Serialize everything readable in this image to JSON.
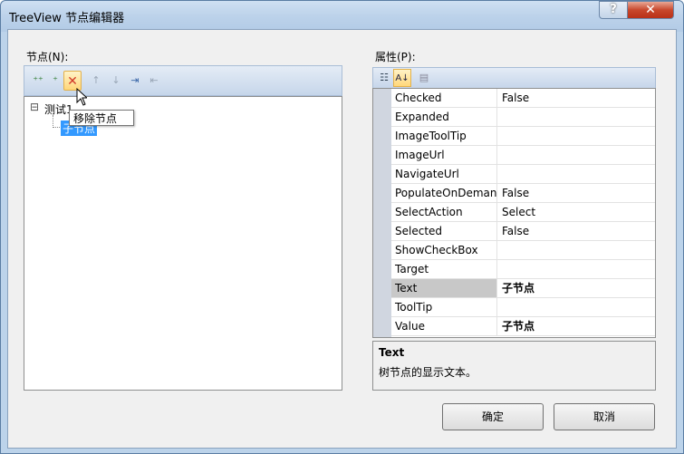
{
  "window": {
    "title": "TreeView 节点编辑器",
    "help_label": "?",
    "close_label": "✕"
  },
  "nodes_panel": {
    "label": "节点(N):",
    "tools": [
      {
        "name": "add-root-node-icon",
        "glyph": "⁺⁺"
      },
      {
        "name": "add-child-node-icon",
        "glyph": "⁺"
      },
      {
        "name": "remove-node-icon",
        "glyph": "✕"
      },
      {
        "name": "move-up-icon",
        "glyph": "↑"
      },
      {
        "name": "move-down-icon",
        "glyph": "↓"
      },
      {
        "name": "indent-icon",
        "glyph": "⇥"
      },
      {
        "name": "outdent-icon",
        "glyph": "⇤"
      }
    ],
    "tree": {
      "root_label": "测试1",
      "root_expander": "⊟",
      "child_label": "子节点"
    },
    "tooltip": "移除节点"
  },
  "properties_panel": {
    "label": "属性(P):",
    "rows": [
      {
        "name": "Checked",
        "value": "False"
      },
      {
        "name": "Expanded",
        "value": ""
      },
      {
        "name": "ImageToolTip",
        "value": ""
      },
      {
        "name": "ImageUrl",
        "value": ""
      },
      {
        "name": "NavigateUrl",
        "value": ""
      },
      {
        "name": "PopulateOnDemand",
        "value": "False"
      },
      {
        "name": "SelectAction",
        "value": "Select"
      },
      {
        "name": "Selected",
        "value": "False"
      },
      {
        "name": "ShowCheckBox",
        "value": ""
      },
      {
        "name": "Target",
        "value": ""
      },
      {
        "name": "Text",
        "value": "子节点"
      },
      {
        "name": "ToolTip",
        "value": ""
      },
      {
        "name": "Value",
        "value": "子节点"
      }
    ],
    "description": {
      "title": "Text",
      "text": "树节点的显示文本。"
    }
  },
  "buttons": {
    "ok": "确定",
    "cancel": "取消"
  }
}
